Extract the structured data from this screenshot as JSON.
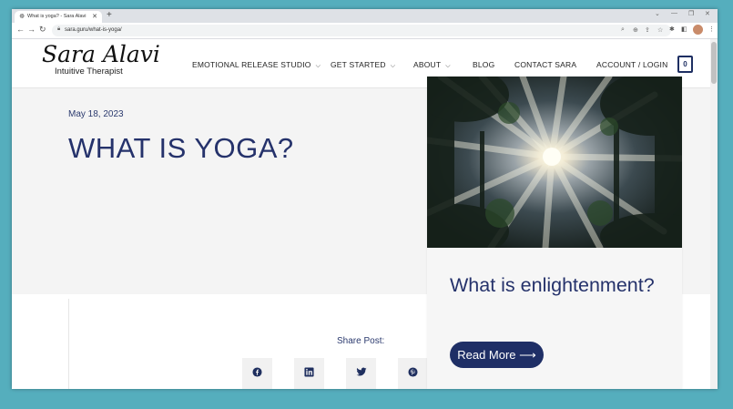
{
  "browser": {
    "tab_title": "What is yoga? - Sara Alavi",
    "tab_close": "✕",
    "new_tab": "+",
    "url": "sara.guru/what-is-yoga/",
    "icons": [
      "back-icon",
      "forward-icon",
      "reload-icon",
      "lock-icon",
      "search-icon",
      "zoom-icon",
      "share-icon",
      "star-icon",
      "extensions-icon",
      "sidebar-icon",
      "avatar",
      "menu-icon"
    ]
  },
  "header": {
    "logo_script": "Sara Alavi",
    "logo_subtitle": "Intuitive Therapist",
    "nav": [
      {
        "label": "EMOTIONAL RELEASE STUDIO",
        "has_dropdown": true
      },
      {
        "label": "GET STARTED",
        "has_dropdown": true
      },
      {
        "label": "ABOUT",
        "has_dropdown": true
      },
      {
        "label": "BLOG",
        "has_dropdown": false
      },
      {
        "label": "CONTACT SARA",
        "has_dropdown": false
      },
      {
        "label": "ACCOUNT / LOGIN",
        "has_dropdown": false
      }
    ],
    "cart_count": "0"
  },
  "post": {
    "date": "May 18, 2023",
    "title": "WHAT IS YOGA?",
    "share_label": "Share Post:",
    "share_buttons": [
      "facebook-icon",
      "linkedin-icon",
      "twitter-icon",
      "pinterest-icon"
    ]
  },
  "card": {
    "title": "What is enlightenment?",
    "button": "Read More ⟶"
  },
  "colors": {
    "navy": "#25326b",
    "hero_bg": "#f4f4f4",
    "desktop_bg": "#55aebd"
  }
}
